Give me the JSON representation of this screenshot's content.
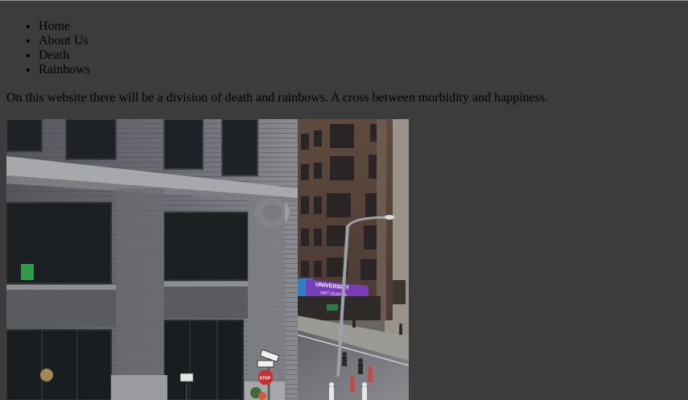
{
  "nav": {
    "items": [
      {
        "label": "Home"
      },
      {
        "label": "About Us"
      },
      {
        "label": "Death"
      },
      {
        "label": "Rainbows"
      }
    ]
  },
  "intro": {
    "text": "On this website there will be a division of death and rainbows. A cross between morbidity and happiness."
  },
  "photo": {
    "sign_banner_text": "UNIVERSITY",
    "sign_banner_subtext": "GIFT CENTER",
    "stop_sign_text": "STOP",
    "accent_sign_color": "#7a3db8",
    "awning_color": "#2f7fc4"
  }
}
